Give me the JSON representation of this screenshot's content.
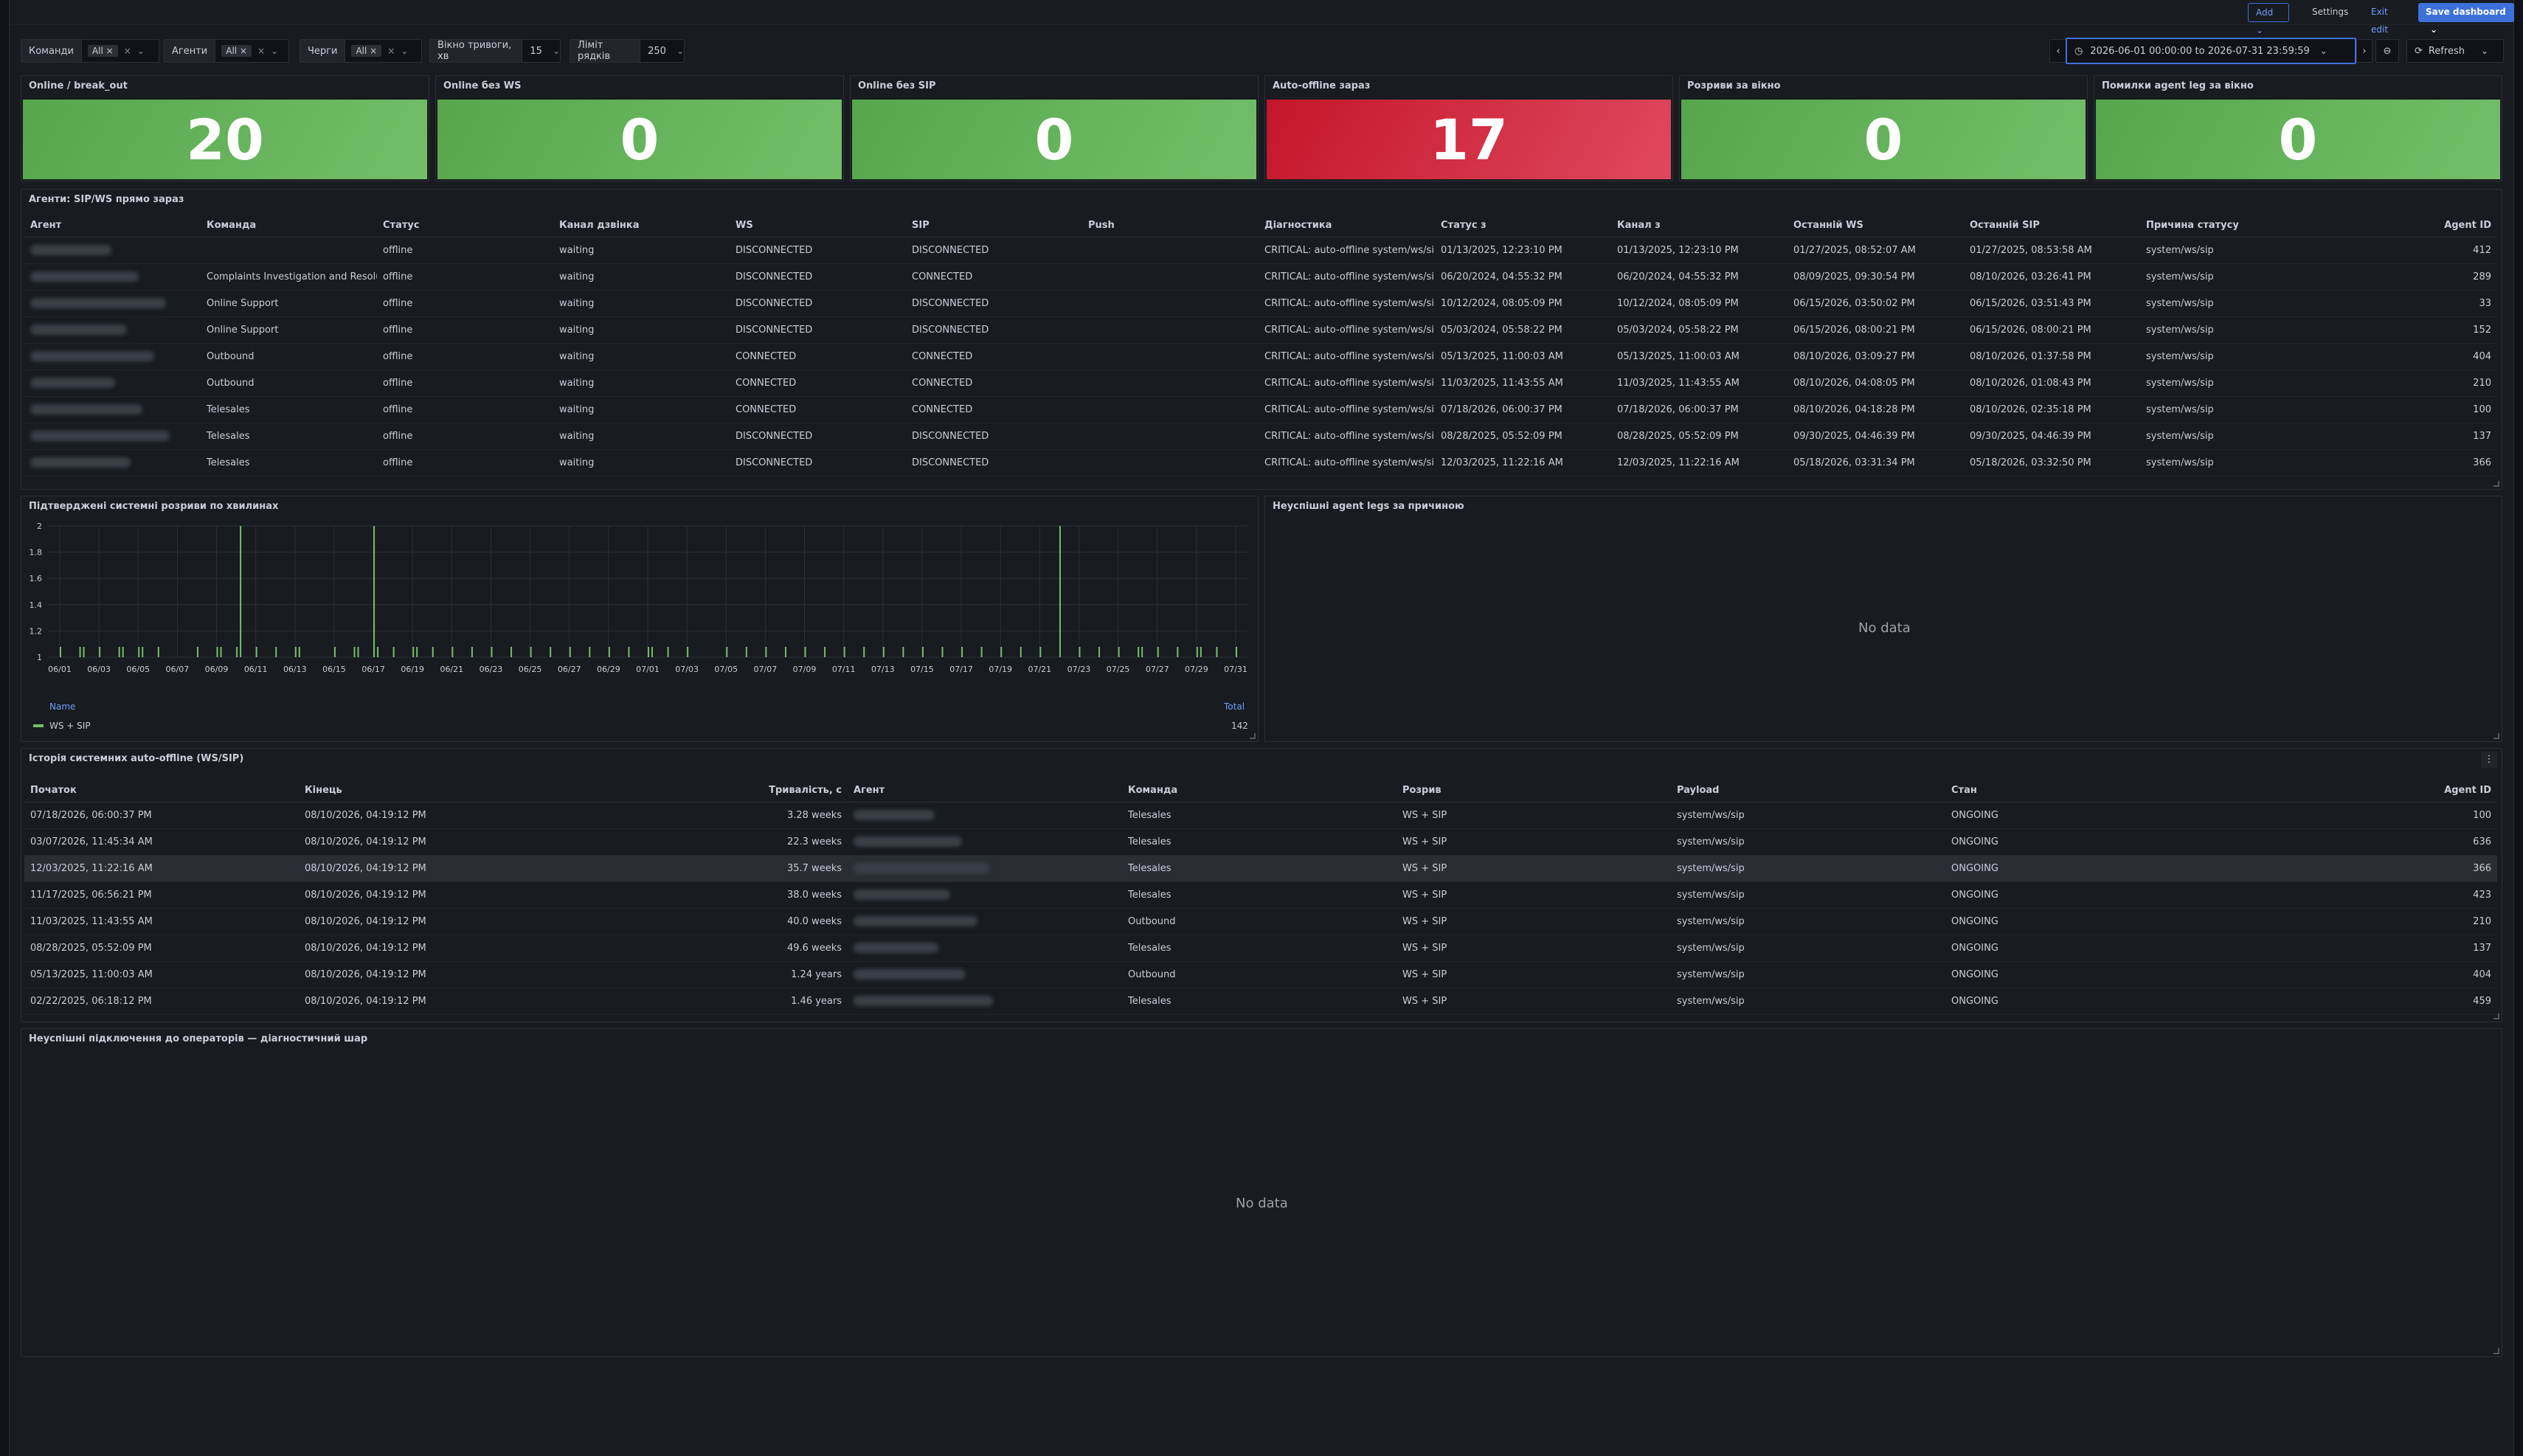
{
  "topbar": {
    "add": "Add",
    "settings": "Settings",
    "exit": "Exit edit",
    "save": "Save dashboard"
  },
  "filters": {
    "teams_label": "Команди",
    "teams_value": "All",
    "agents_label": "Агенти",
    "agents_value": "All",
    "queues_label": "Черги",
    "queues_value": "All",
    "window_label": "Вікно тривоги, хв",
    "window_value": "15",
    "limit_label": "Ліміт рядків",
    "limit_value": "250"
  },
  "timerange": {
    "value": "2026-06-01 00:00:00 to 2026-07-31 23:59:59",
    "refresh": "Refresh"
  },
  "stats": [
    {
      "title": "Online / break_out",
      "value": "20",
      "color": "green"
    },
    {
      "title": "Online без WS",
      "value": "0",
      "color": "green"
    },
    {
      "title": "Online без SIP",
      "value": "0",
      "color": "green"
    },
    {
      "title": "Auto-offline зараз",
      "value": "17",
      "color": "red"
    },
    {
      "title": "Розриви за вікно",
      "value": "0",
      "color": "green"
    },
    {
      "title": "Помилки agent leg за вікно",
      "value": "0",
      "color": "green"
    }
  ],
  "agents_panel": {
    "title": "Агенти: SIP/WS прямо зараз",
    "headers": [
      "Агент",
      "Команда",
      "Статус",
      "Канал дзвінка",
      "WS",
      "SIP",
      "Push",
      "Діагностика",
      "Статус з",
      "Канал з",
      "Останній WS",
      "Останній SIP",
      "Причина статусу",
      "Agent ID"
    ],
    "rows": [
      [
        "",
        "",
        "offline",
        "waiting",
        "DISCONNECTED",
        "DISCONNECTED",
        "",
        "CRITICAL: auto-offline system/ws/sip",
        "01/13/2025, 12:23:10 PM",
        "01/13/2025, 12:23:10 PM",
        "01/27/2025, 08:52:07 AM",
        "01/27/2025, 08:53:58 AM",
        "system/ws/sip",
        "412"
      ],
      [
        "",
        "Complaints Investigation and Resolution",
        "offline",
        "waiting",
        "DISCONNECTED",
        "CONNECTED",
        "",
        "CRITICAL: auto-offline system/ws/sip",
        "06/20/2024, 04:55:32 PM",
        "06/20/2024, 04:55:32 PM",
        "08/09/2025, 09:30:54 PM",
        "08/10/2026, 03:26:41 PM",
        "system/ws/sip",
        "289"
      ],
      [
        "",
        "Online Support",
        "offline",
        "waiting",
        "DISCONNECTED",
        "DISCONNECTED",
        "",
        "CRITICAL: auto-offline system/ws/sip",
        "10/12/2024, 08:05:09 PM",
        "10/12/2024, 08:05:09 PM",
        "06/15/2026, 03:50:02 PM",
        "06/15/2026, 03:51:43 PM",
        "system/ws/sip",
        "33"
      ],
      [
        "",
        "Online Support",
        "offline",
        "waiting",
        "DISCONNECTED",
        "DISCONNECTED",
        "",
        "CRITICAL: auto-offline system/ws/sip",
        "05/03/2024, 05:58:22 PM",
        "05/03/2024, 05:58:22 PM",
        "06/15/2026, 08:00:21 PM",
        "06/15/2026, 08:00:21 PM",
        "system/ws/sip",
        "152"
      ],
      [
        "",
        "Outbound",
        "offline",
        "waiting",
        "CONNECTED",
        "CONNECTED",
        "",
        "CRITICAL: auto-offline system/ws/sip",
        "05/13/2025, 11:00:03 AM",
        "05/13/2025, 11:00:03 AM",
        "08/10/2026, 03:09:27 PM",
        "08/10/2026, 01:37:58 PM",
        "system/ws/sip",
        "404"
      ],
      [
        "",
        "Outbound",
        "offline",
        "waiting",
        "CONNECTED",
        "CONNECTED",
        "",
        "CRITICAL: auto-offline system/ws/sip",
        "11/03/2025, 11:43:55 AM",
        "11/03/2025, 11:43:55 AM",
        "08/10/2026, 04:08:05 PM",
        "08/10/2026, 01:08:43 PM",
        "system/ws/sip",
        "210"
      ],
      [
        "",
        "Telesales",
        "offline",
        "waiting",
        "CONNECTED",
        "CONNECTED",
        "",
        "CRITICAL: auto-offline system/ws/sip",
        "07/18/2026, 06:00:37 PM",
        "07/18/2026, 06:00:37 PM",
        "08/10/2026, 04:18:28 PM",
        "08/10/2026, 02:35:18 PM",
        "system/ws/sip",
        "100"
      ],
      [
        "",
        "Telesales",
        "offline",
        "waiting",
        "DISCONNECTED",
        "DISCONNECTED",
        "",
        "CRITICAL: auto-offline system/ws/sip",
        "08/28/2025, 05:52:09 PM",
        "08/28/2025, 05:52:09 PM",
        "09/30/2025, 04:46:39 PM",
        "09/30/2025, 04:46:39 PM",
        "system/ws/sip",
        "137"
      ],
      [
        "",
        "Telesales",
        "offline",
        "waiting",
        "DISCONNECTED",
        "DISCONNECTED",
        "",
        "CRITICAL: auto-offline system/ws/sip",
        "12/03/2025, 11:22:16 AM",
        "12/03/2025, 11:22:16 AM",
        "05/18/2026, 03:31:34 PM",
        "05/18/2026, 03:32:50 PM",
        "system/ws/sip",
        "366"
      ]
    ]
  },
  "breaks_panel": {
    "title": "Підтверджені системні розриви по хвилинах",
    "legend_name_header": "Name",
    "legend_total_header": "Total",
    "legend_series": "WS + SIP",
    "legend_total": "142"
  },
  "chart_data": {
    "type": "bar",
    "title": "Підтверджені системні розриви по хвилинах",
    "xlabel": "",
    "ylabel": "",
    "ylim": [
      1,
      2
    ],
    "yticks": [
      "1",
      "1.2",
      "1.4",
      "1.6",
      "1.8",
      "2"
    ],
    "xticks": [
      "06/01",
      "06/03",
      "06/05",
      "06/07",
      "06/09",
      "06/11",
      "06/13",
      "06/15",
      "06/17",
      "06/19",
      "06/21",
      "06/23",
      "06/25",
      "06/27",
      "06/29",
      "07/01",
      "07/03",
      "07/05",
      "07/07",
      "07/09",
      "07/11",
      "07/13",
      "07/15",
      "07/17",
      "07/19",
      "07/21",
      "07/23",
      "07/25",
      "07/27",
      "07/29",
      "07/31"
    ],
    "grid": true,
    "legend_position": "bottom",
    "series": [
      {
        "name": "WS + SIP",
        "color": "#73bf69",
        "points": [
          [
            "06/01",
            1
          ],
          [
            "06/02",
            1
          ],
          [
            "06/02",
            1
          ],
          [
            "06/03",
            1
          ],
          [
            "06/04",
            1
          ],
          [
            "06/04",
            1
          ],
          [
            "06/05",
            1
          ],
          [
            "06/05",
            1
          ],
          [
            "06/06",
            1
          ],
          [
            "06/08",
            1
          ],
          [
            "06/09",
            1
          ],
          [
            "06/09",
            1
          ],
          [
            "06/10",
            1
          ],
          [
            "06/10",
            2
          ],
          [
            "06/11",
            1
          ],
          [
            "06/12",
            1
          ],
          [
            "06/13",
            1
          ],
          [
            "06/13",
            1
          ],
          [
            "06/15",
            1
          ],
          [
            "06/16",
            1
          ],
          [
            "06/16",
            1
          ],
          [
            "06/17",
            2
          ],
          [
            "06/17",
            1
          ],
          [
            "06/18",
            1
          ],
          [
            "06/19",
            1
          ],
          [
            "06/19",
            1
          ],
          [
            "06/20",
            1
          ],
          [
            "06/21",
            1
          ],
          [
            "06/22",
            1
          ],
          [
            "06/23",
            1
          ],
          [
            "06/24",
            1
          ],
          [
            "06/25",
            1
          ],
          [
            "06/26",
            1
          ],
          [
            "06/27",
            1
          ],
          [
            "06/28",
            1
          ],
          [
            "06/29",
            1
          ],
          [
            "06/30",
            1
          ],
          [
            "07/01",
            1
          ],
          [
            "07/01",
            1
          ],
          [
            "07/02",
            1
          ],
          [
            "07/03",
            1
          ],
          [
            "07/05",
            1
          ],
          [
            "07/06",
            1
          ],
          [
            "07/07",
            1
          ],
          [
            "07/08",
            1
          ],
          [
            "07/09",
            1
          ],
          [
            "07/10",
            1
          ],
          [
            "07/11",
            1
          ],
          [
            "07/12",
            1
          ],
          [
            "07/13",
            1
          ],
          [
            "07/14",
            1
          ],
          [
            "07/15",
            1
          ],
          [
            "07/16",
            1
          ],
          [
            "07/17",
            1
          ],
          [
            "07/18",
            1
          ],
          [
            "07/19",
            1
          ],
          [
            "07/20",
            1
          ],
          [
            "07/21",
            1
          ],
          [
            "07/22",
            2
          ],
          [
            "07/23",
            1
          ],
          [
            "07/24",
            1
          ],
          [
            "07/25",
            1
          ],
          [
            "07/26",
            1
          ],
          [
            "07/26",
            1
          ],
          [
            "07/27",
            1
          ],
          [
            "07/28",
            1
          ],
          [
            "07/29",
            1
          ],
          [
            "07/29",
            1
          ],
          [
            "07/30",
            1
          ],
          [
            "07/31",
            1
          ]
        ]
      }
    ]
  },
  "legs_panel": {
    "title": "Неуспішні agent legs за причиною",
    "nodata": "No data"
  },
  "history_panel": {
    "title": "Історія системних auto-offline (WS/SIP)",
    "headers": [
      "Початок",
      "Кінець",
      "Тривалість, с",
      "Агент",
      "Команда",
      "Розрив",
      "Payload",
      "Стан",
      "Agent ID"
    ],
    "rows": [
      [
        "07/18/2026, 06:00:37 PM",
        "08/10/2026, 04:19:12 PM",
        "3.28 weeks",
        "",
        "Telesales",
        "WS + SIP",
        "system/ws/sip",
        "ONGOING",
        "100"
      ],
      [
        "03/07/2026, 11:45:34 AM",
        "08/10/2026, 04:19:12 PM",
        "22.3 weeks",
        "",
        "Telesales",
        "WS + SIP",
        "system/ws/sip",
        "ONGOING",
        "636"
      ],
      [
        "12/03/2025, 11:22:16 AM",
        "08/10/2026, 04:19:12 PM",
        "35.7 weeks",
        "",
        "Telesales",
        "WS + SIP",
        "system/ws/sip",
        "ONGOING",
        "366"
      ],
      [
        "11/17/2025, 06:56:21 PM",
        "08/10/2026, 04:19:12 PM",
        "38.0 weeks",
        "",
        "Telesales",
        "WS + SIP",
        "system/ws/sip",
        "ONGOING",
        "423"
      ],
      [
        "11/03/2025, 11:43:55 AM",
        "08/10/2026, 04:19:12 PM",
        "40.0 weeks",
        "",
        "Outbound",
        "WS + SIP",
        "system/ws/sip",
        "ONGOING",
        "210"
      ],
      [
        "08/28/2025, 05:52:09 PM",
        "08/10/2026, 04:19:12 PM",
        "49.6 weeks",
        "",
        "Telesales",
        "WS + SIP",
        "system/ws/sip",
        "ONGOING",
        "137"
      ],
      [
        "05/13/2025, 11:00:03 AM",
        "08/10/2026, 04:19:12 PM",
        "1.24 years",
        "",
        "Outbound",
        "WS + SIP",
        "system/ws/sip",
        "ONGOING",
        "404"
      ],
      [
        "02/22/2025, 06:18:12 PM",
        "08/10/2026, 04:19:12 PM",
        "1.46 years",
        "",
        "Telesales",
        "WS + SIP",
        "system/ws/sip",
        "ONGOING",
        "459"
      ]
    ]
  },
  "failed_panel": {
    "title": "Неуспішні підключення до операторів — діагностичний шар",
    "nodata": "No data"
  }
}
